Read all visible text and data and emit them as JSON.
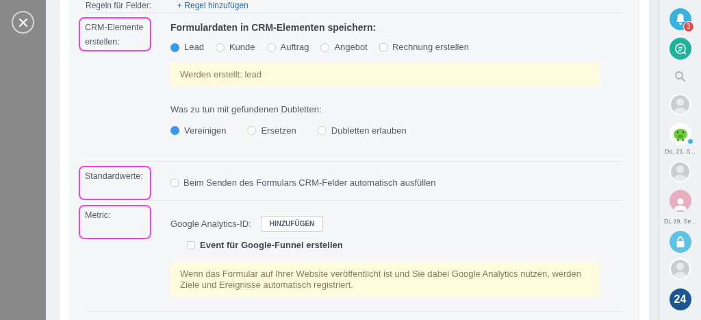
{
  "top_row": {
    "label": "Regeln für Felder:",
    "link": "+ Regel hinzufügen"
  },
  "sections": [
    {
      "label": "CRM-Elemente erstellen:",
      "highlighted": true,
      "kind": "crm"
    },
    {
      "label": "Standardwerte:",
      "highlighted": true,
      "kind": "defaults"
    },
    {
      "label": "Metric:",
      "highlighted": true,
      "kind": "metric"
    }
  ],
  "crm": {
    "heading": "Formulardaten in CRM-Elementen speichern:",
    "options": [
      {
        "label": "Lead",
        "kind": "radio",
        "selected": true
      },
      {
        "label": "Kunde",
        "kind": "radio",
        "selected": false
      },
      {
        "label": "Auftrag",
        "kind": "radio",
        "selected": false
      },
      {
        "label": "Angebot",
        "kind": "radio",
        "selected": false
      },
      {
        "label": "Rechnung erstellen",
        "kind": "checkbox",
        "checked": false
      }
    ],
    "notice": "Werden erstellt: lead",
    "duplicates_label": "Was zu tun mit gefundenen Dubletten:",
    "duplicates": [
      {
        "label": "Vereinigen",
        "selected": true
      },
      {
        "label": "Ersetzen",
        "selected": false
      },
      {
        "label": "Dubletten erlauben",
        "selected": false
      }
    ]
  },
  "defaults": {
    "checkbox": {
      "label": "Beim Senden des Formulars CRM-Felder automatisch ausfüllen",
      "checked": false
    }
  },
  "metric": {
    "ga_label": "Google Analytics-ID:",
    "ga_button": "HINZUFÜGEN",
    "event_checkbox": {
      "label": "Event für Google-Funnel erstellen",
      "checked": false
    },
    "notice": "Wenn das Formular auf Ihrer Website veröffentlicht ist und Sie dabei Google Analytics nutzen, werden Ziele und Ereignisse automatisch registriert."
  },
  "sidebar": [
    {
      "kind": "bell",
      "badge": "3"
    },
    {
      "kind": "chat"
    },
    {
      "kind": "search"
    },
    {
      "kind": "avatar"
    },
    {
      "kind": "piggy"
    },
    {
      "kind": "date",
      "text": "Do, 21. S..."
    },
    {
      "kind": "avatar"
    },
    {
      "kind": "silhouette"
    },
    {
      "kind": "date",
      "text": "Di, 19. Se..."
    },
    {
      "kind": "lock"
    },
    {
      "kind": "avatar"
    },
    {
      "kind": "number",
      "text": "24"
    }
  ]
}
